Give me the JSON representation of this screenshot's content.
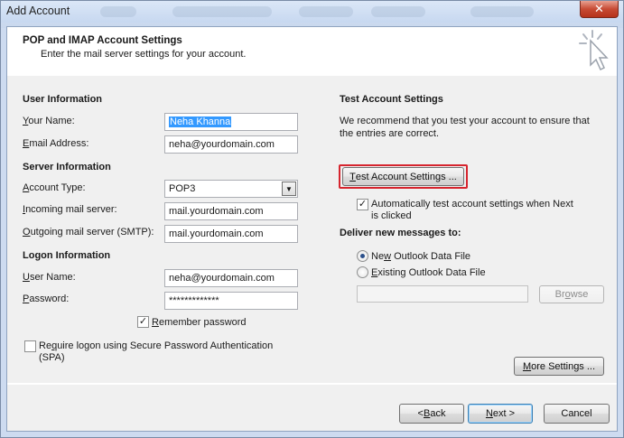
{
  "window": {
    "title": "Add Account",
    "close_glyph": "✕"
  },
  "header": {
    "title": "POP and IMAP Account Settings",
    "subtitle": "Enter the mail server settings for your account.",
    "icon": "cursor-click-icon"
  },
  "user_info": {
    "title": "User Information",
    "name_label_ul": "Y",
    "name_label_rest": "our Name:",
    "name_value": "Neha Khanna",
    "email_label_ul": "E",
    "email_label_rest": "mail Address:",
    "email_value": "neha@yourdomain.com"
  },
  "server_info": {
    "title": "Server Information",
    "account_type_label_ul": "A",
    "account_type_label_rest": "ccount Type:",
    "account_type_value": "POP3",
    "incoming_label_ul": "I",
    "incoming_label_rest": "ncoming mail server:",
    "incoming_value": "mail.yourdomain.com",
    "outgoing_label_ul": "O",
    "outgoing_label_rest": "utgoing mail server (SMTP):",
    "outgoing_value": "mail.yourdomain.com"
  },
  "logon_info": {
    "title": "Logon Information",
    "username_label_ul": "U",
    "username_label_rest": "ser Name:",
    "username_value": "neha@yourdomain.com",
    "password_label_ul": "P",
    "password_label_rest": "assword:",
    "password_value": "*************",
    "remember_label_ul": "R",
    "remember_label_rest": "emember password",
    "remember_checked": true,
    "spa_label_line1_pre": "Re",
    "spa_label_ul": "q",
    "spa_label_line1_rest": "uire logon using Secure Password Authentication",
    "spa_label_line2": "(SPA)",
    "spa_checked": false
  },
  "test_settings": {
    "title": "Test Account Settings",
    "description_line1": "We recommend that you test your account to ensure that",
    "description_line2": "the entries are correct.",
    "test_button_ul": "T",
    "test_button_rest": "est Account Settings ...",
    "auto_test_line1": "Automatically test account settings when Next",
    "auto_test_line2": "is clicked",
    "auto_test_checked": true
  },
  "deliver": {
    "title": "Deliver new messages to:",
    "new_pre": "Ne",
    "new_ul": "w",
    "new_rest": " Outlook Data File",
    "existing_pre": "",
    "existing_ul": "E",
    "existing_rest": "xisting Outlook Data File",
    "selected": "new",
    "existing_path_value": "",
    "browse_label_pre": "Br",
    "browse_label_ul": "o",
    "browse_label_rest": "wse"
  },
  "more_settings": {
    "label_ul": "M",
    "label_rest": "ore Settings ..."
  },
  "footer": {
    "back_pre": "< ",
    "back_ul": "B",
    "back_rest": "ack",
    "next_ul": "N",
    "next_rest": "ext >",
    "cancel": "Cancel"
  },
  "colors": {
    "highlight": "#d6252e",
    "selection": "#3399ff"
  }
}
